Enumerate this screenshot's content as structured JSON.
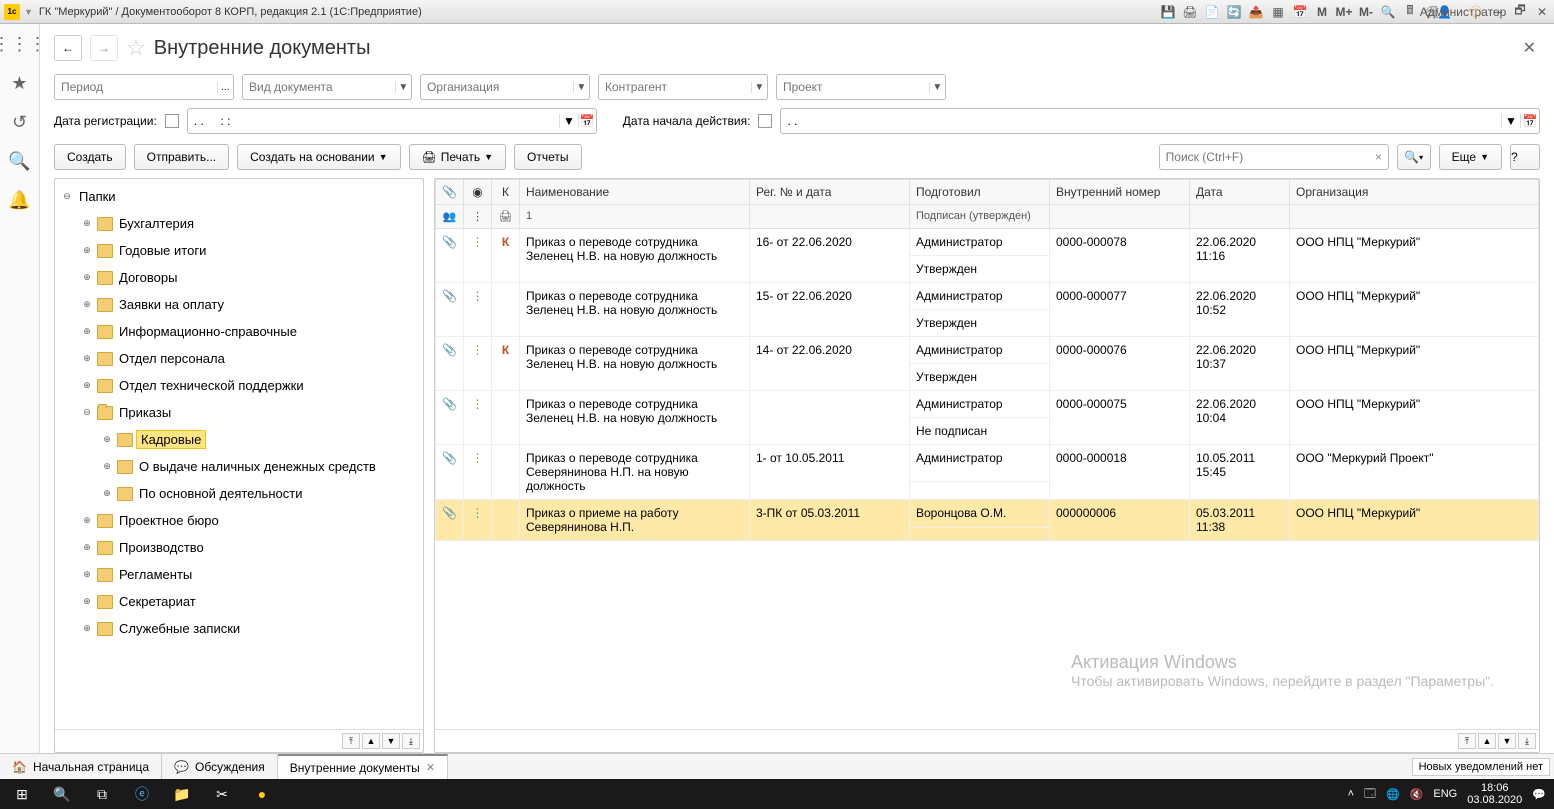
{
  "titlebar": {
    "title": "ГК \"Меркурий\" / Документооборот 8 КОРП, редакция 2.1  (1С:Предприятие)",
    "badges": {
      "m": "M",
      "mplus": "M+",
      "mminus": "M-"
    },
    "user": "Администратор"
  },
  "page": {
    "title": "Внутренние документы"
  },
  "filters": {
    "period": {
      "placeholder": "Период"
    },
    "doctype": {
      "placeholder": "Вид документа"
    },
    "org": {
      "placeholder": "Организация"
    },
    "counterparty": {
      "placeholder": "Контрагент"
    },
    "project": {
      "placeholder": "Проект"
    },
    "reg_date_label": "Дата регистрации:",
    "reg_date_value": ". .     : :",
    "start_date_label": "Дата начала действия:",
    "start_date_value": ". ."
  },
  "toolbar": {
    "create": "Создать",
    "send": "Отправить...",
    "create_based": "Создать на основании",
    "print": "Печать",
    "reports": "Отчеты",
    "search_placeholder": "Поиск (Ctrl+F)",
    "more": "Еще",
    "help": "?"
  },
  "tree": {
    "root": "Папки",
    "items": [
      {
        "label": "Бухгалтерия",
        "level": 1
      },
      {
        "label": "Годовые итоги",
        "level": 1
      },
      {
        "label": "Договоры",
        "level": 1
      },
      {
        "label": "Заявки на оплату",
        "level": 1
      },
      {
        "label": "Информационно-справочные",
        "level": 1
      },
      {
        "label": "Отдел персонала",
        "level": 1
      },
      {
        "label": "Отдел технической поддержки",
        "level": 1
      },
      {
        "label": "Приказы",
        "level": 1,
        "open": true
      },
      {
        "label": "Кадровые",
        "level": 2,
        "selected": true
      },
      {
        "label": "О выдаче наличных денежных средств",
        "level": 2
      },
      {
        "label": "По основной деятельности",
        "level": 2
      },
      {
        "label": "Проектное бюро",
        "level": 1
      },
      {
        "label": "Производство",
        "level": 1
      },
      {
        "label": "Регламенты",
        "level": 1
      },
      {
        "label": "Секретариат",
        "level": 1
      },
      {
        "label": "Служебные записки",
        "level": 1
      }
    ]
  },
  "table": {
    "headers": {
      "k": "К",
      "name": "Наименование",
      "reg": "Рег. № и дата",
      "author": "Подготовил",
      "author2": "Подписан (утвержден)",
      "internal": "Внутренний номер",
      "date": "Дата",
      "org": "Организация",
      "num1": "1"
    },
    "rows": [
      {
        "k": "К",
        "name": "Приказ о переводе сотрудника Зеленец Н.В. на новую должность",
        "reg": "16- от 22.06.2020",
        "author": "Администратор",
        "status": "Утвержден",
        "internal": "0000-000078",
        "date": "22.06.2020 11:16",
        "org": "ООО НПЦ \"Меркурий\""
      },
      {
        "k": "",
        "name": "Приказ о переводе сотрудника Зеленец Н.В. на новую должность",
        "reg": "15- от 22.06.2020",
        "author": "Администратор",
        "status": "Утвержден",
        "internal": "0000-000077",
        "date": "22.06.2020 10:52",
        "org": "ООО НПЦ \"Меркурий\""
      },
      {
        "k": "К",
        "name": "Приказ о переводе сотрудника Зеленец Н.В. на новую должность",
        "reg": "14- от 22.06.2020",
        "author": "Администратор",
        "status": "Утвержден",
        "internal": "0000-000076",
        "date": "22.06.2020 10:37",
        "org": "ООО НПЦ \"Меркурий\""
      },
      {
        "k": "",
        "name": "Приказ о переводе сотрудника Зеленец Н.В. на новую должность",
        "reg": "",
        "author": "Администратор",
        "status": "Не подписан",
        "internal": "0000-000075",
        "date": "22.06.2020 10:04",
        "org": "ООО НПЦ \"Меркурий\""
      },
      {
        "k": "",
        "name": "Приказ о переводе сотрудника Северяниновa Н.П. на новую должность",
        "reg": "1- от 10.05.2011",
        "author": "Администратор",
        "status": "",
        "internal": "0000-000018",
        "date": "10.05.2011 15:45",
        "org": "ООО \"Меркурий Проект\""
      },
      {
        "k": "",
        "name": "Приказ о приеме на работу Северянинова Н.П.",
        "reg": "3-ПК от 05.03.2011",
        "author": "Воронцова О.М.",
        "status": "",
        "internal": "000000006",
        "date": "05.03.2011 11:38",
        "org": "ООО НПЦ \"Меркурий\"",
        "selected": true
      }
    ]
  },
  "tabs": {
    "home": "Начальная страница",
    "discuss": "Обсуждения",
    "current": "Внутренние документы",
    "notif": "Новых уведомлений нет"
  },
  "watermark": {
    "title": "Активация Windows",
    "sub": "Чтобы активировать Windows, перейдите в раздел \"Параметры\"."
  },
  "taskbar": {
    "lang": "ENG",
    "time": "18:06",
    "date": "03.08.2020"
  }
}
